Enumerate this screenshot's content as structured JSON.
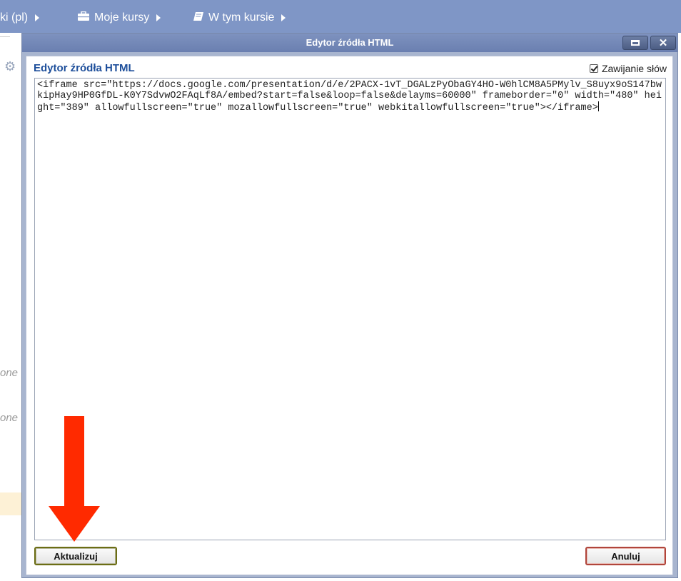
{
  "topnav": {
    "items": [
      {
        "label": "ki (pl)",
        "icon": "none"
      },
      {
        "label": "Moje kursy",
        "icon": "briefcase-icon"
      },
      {
        "label": "W tym kursie",
        "icon": "book-icon"
      }
    ]
  },
  "background": {
    "fragments": [
      "one",
      "one"
    ]
  },
  "dialog": {
    "title": "Edytor źródła HTML",
    "panel_title": "Edytor źródła HTML",
    "wrap_label": "Zawijanie słów",
    "wrap_checked": true,
    "source": "<iframe src=\"https://docs.google.com/presentation/d/e/2PACX-1vT_DGALzPyObaGY4HO-W0hlCM8A5PMylv_S8uyx9oS147bwkipHay9HP0GfDL-K0Y7SdvwO2FAqLf8A/embed?start=false&loop=false&delayms=60000\" frameborder=\"0\" width=\"480\" height=\"389\" allowfullscreen=\"true\" mozallowfullscreen=\"true\" webkitallowfullscreen=\"true\"></iframe>",
    "update_label": "Aktualizuj",
    "cancel_label": "Anuluj"
  },
  "colors": {
    "nav_bg": "#7f96c6",
    "title_blue": "#1e4f9b",
    "arrow_red": "#ff2a00"
  }
}
